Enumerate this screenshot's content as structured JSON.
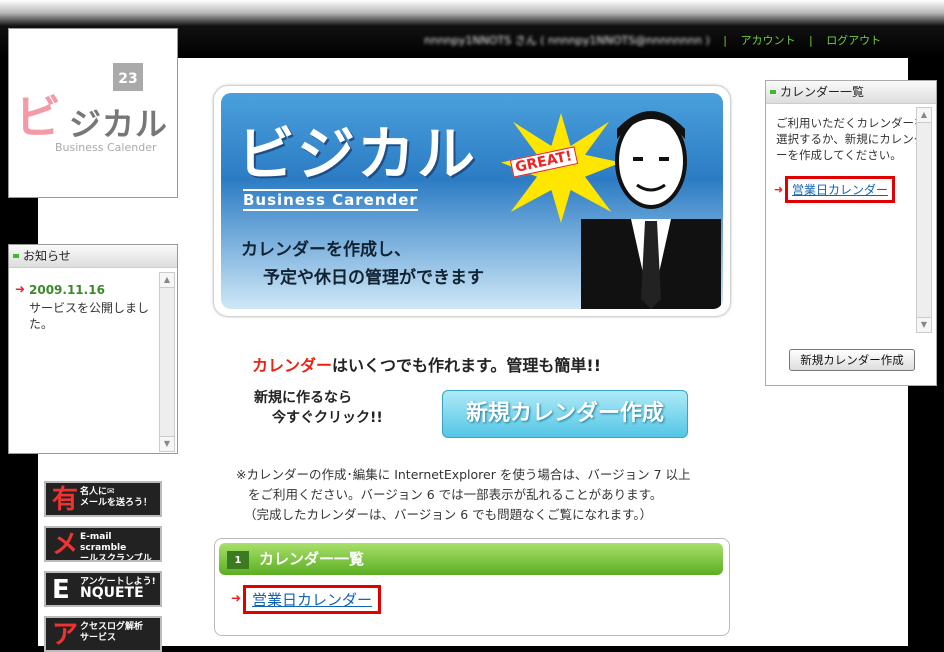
{
  "header": {
    "user_name": "nnnnpy1NNOTS",
    "san": "さん",
    "user_email": "( nnnnpy1NNOTS@nnnnnnnn )",
    "account": "アカウント",
    "logout": "ログアウト"
  },
  "logo": {
    "kana_big": "ビ",
    "kana_rest": "ジカル",
    "calendar_number": "23",
    "sub": "Business Calender"
  },
  "news": {
    "title": "お知らせ",
    "date": "2009.11.16",
    "text": "サービスを公開しました。"
  },
  "ads": [
    {
      "big": "有",
      "line1": "名人に✉",
      "line2": "メールを送ろう！"
    },
    {
      "big": "メ",
      "line1": "E-mail scramble",
      "line2": "ールスクランブル"
    },
    {
      "big": "E",
      "line1": "アンケートしよう!",
      "line2": "NQUETE"
    },
    {
      "big": "ア",
      "line1": "クセスログ解析",
      "line2": "サービス"
    }
  ],
  "banner": {
    "title": "ビジカル",
    "subtitle": "Business Carender",
    "great": "GREAT!",
    "line1": "カレンダーを作成し、",
    "line2": "予定や休日の管理ができます"
  },
  "promo": {
    "tag_red": "カレンダー",
    "tag_rest": "はいくつでも作れます。管理も簡単!!",
    "now_line1": "新規に作るなら",
    "now_line2": "今すぐクリック!!",
    "new_button": "新規カレンダー作成"
  },
  "note": {
    "line1": "※カレンダーの作成･編集に InternetExplorer を使う場合は、バージョン 7 以上",
    "line2": "をご利用ください。バージョン 6 では一部表示が乱れることがあります。",
    "line3": "（完成したカレンダーは、バージョン 6 でも問題なくご覧になれます。）"
  },
  "calendar_list": {
    "title": "カレンダー一覧",
    "icon_number": "1",
    "items": [
      "営業日カレンダー"
    ]
  },
  "right_panel": {
    "title": "カレンダー一覧",
    "desc": "ご利用いただくカレンダーを選択するか、新規にカレンダーを作成してください。",
    "item": "営業日カレンダー",
    "button": "新規カレンダー作成"
  }
}
